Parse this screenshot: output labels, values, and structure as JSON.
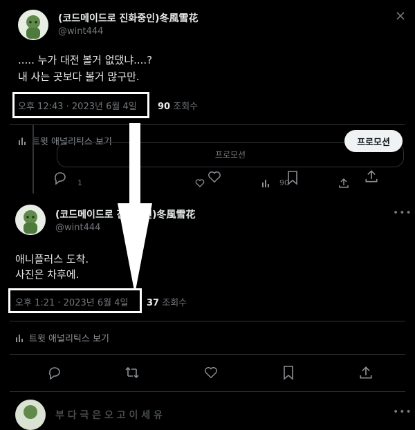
{
  "tweet1": {
    "display_name": "(코드메이드로 진화중인)冬風雪花",
    "handle": "@wint444",
    "text_line1": "..... 누가 대전 볼거 없댔냐....?",
    "text_line2": "내 사는 곳보다 볼거 많구만.",
    "timestamp": "오후 12:43 · 2023년 6월 4일",
    "views_count": "90",
    "views_label": "조회수",
    "analytics_label": "트윗 애널리틱스 보기",
    "promote_label": "프로모션",
    "promo_card_label": "프로모션",
    "reply_count": "1",
    "stat_count": "90"
  },
  "tweet2": {
    "display_name": "(코드메이드로 진화중인)冬風雪花",
    "handle": "@wint444",
    "text_line1": "애니플러스 도착.",
    "text_line2": "사진은 차후에.",
    "timestamp": "오후 1:21 · 2023년 6월 4일",
    "views_count": "37",
    "views_label": "조회수",
    "analytics_label": "트윗 애널리틱스 보기"
  },
  "tweet3": {
    "partial_text": "부 다 극 은 오 고 이 세 유"
  },
  "colors": {
    "background": "#000000",
    "text": "#e7e9ea",
    "muted": "#71767b",
    "highlight": "#ffffff"
  }
}
